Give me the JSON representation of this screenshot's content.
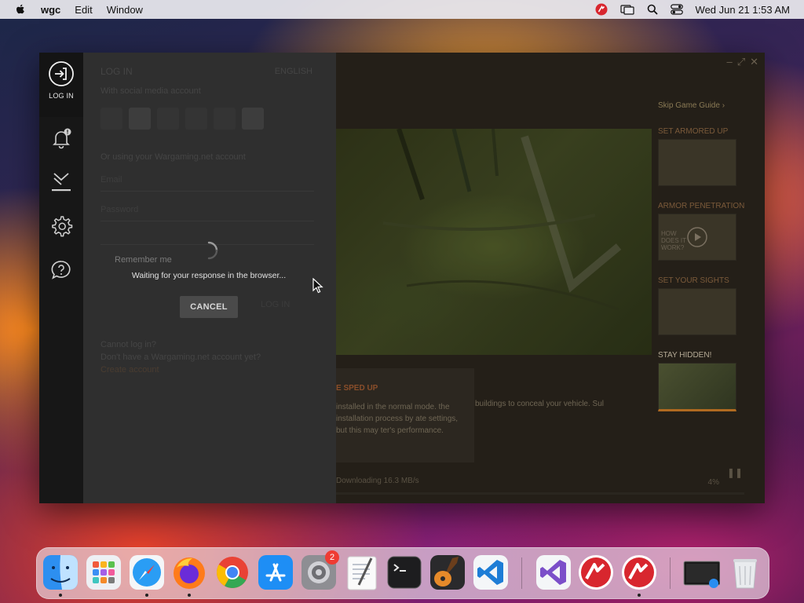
{
  "menubar": {
    "app_name": "wgc",
    "items": [
      "Edit",
      "Window"
    ],
    "clock": "Wed Jun 21  1:53 AM"
  },
  "sidebar": {
    "login_label": "LOG IN"
  },
  "login_panel": {
    "title": "LOG IN",
    "language": "ENGLISH",
    "social_label": "With social media account",
    "or_label": "Or using your Wargaming.net account",
    "email_placeholder": "Email",
    "password_placeholder": "Password",
    "remember_label": "Remember me",
    "login_button": "LOG IN",
    "cannot_login": "Cannot log in?",
    "no_account": "Don't have a Wargaming.net account yet?",
    "create_account": "Create account",
    "waiting_text": "Waiting for your response in the browser...",
    "cancel_label": "CANCEL"
  },
  "background": {
    "skip_guide": "Skip Game Guide  ›",
    "side_sections": [
      "SET ARMORED UP",
      "ARMOR PENETRATION",
      "SET YOUR SIGHTS",
      "STAY HIDDEN!"
    ],
    "video_caption": "HOW DOES IT WORK?",
    "article_head": "E SPED UP",
    "article_body": "installed in the normal mode. the installation process by ate settings, but this may ter's performance.",
    "article_body_2": "buildings to conceal your vehicle. Sul",
    "status_text": "Downloading 16.3 MB/s",
    "progress_pct": "4%"
  },
  "dock": {
    "apps": [
      "Finder",
      "Launchpad",
      "Safari",
      "Firefox",
      "Chrome",
      "App Store",
      "System Settings",
      "TextEdit",
      "Terminal",
      "GarageBand",
      "Visual Studio Code",
      "Visual Studio",
      "Wargaming Game Center",
      "Wargaming Game Center",
      "Screen Sharing",
      "Trash"
    ],
    "settings_badge": "2"
  },
  "colors": {
    "sidebar": "#171717",
    "panel": "#2f2f2f",
    "cancel_button": "#4a4a4a",
    "accent": "#b0452c"
  }
}
